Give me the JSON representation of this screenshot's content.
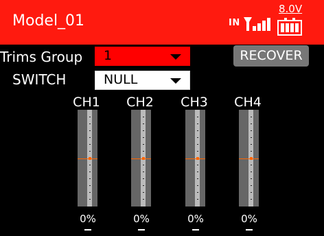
{
  "header": {
    "title": "Model_01",
    "signal_label": "IN",
    "voltage": "8.0V"
  },
  "trims": {
    "label": "Trims Group",
    "value": "1"
  },
  "switch": {
    "label": "SWITCH",
    "value": "NULL"
  },
  "recover_label": "RECOVER",
  "channels": [
    {
      "name": "CH1",
      "percent": "0%",
      "trim": "–"
    },
    {
      "name": "CH2",
      "percent": "0%",
      "trim": "–"
    },
    {
      "name": "CH3",
      "percent": "0%",
      "trim": "–"
    },
    {
      "name": "CH4",
      "percent": "0%",
      "trim": "–"
    }
  ],
  "colors": {
    "header_bg": "#ff1a0f",
    "dropdown_red": "#ff0000",
    "trim_marker": "#ff6600",
    "button_gray": "#777777"
  }
}
